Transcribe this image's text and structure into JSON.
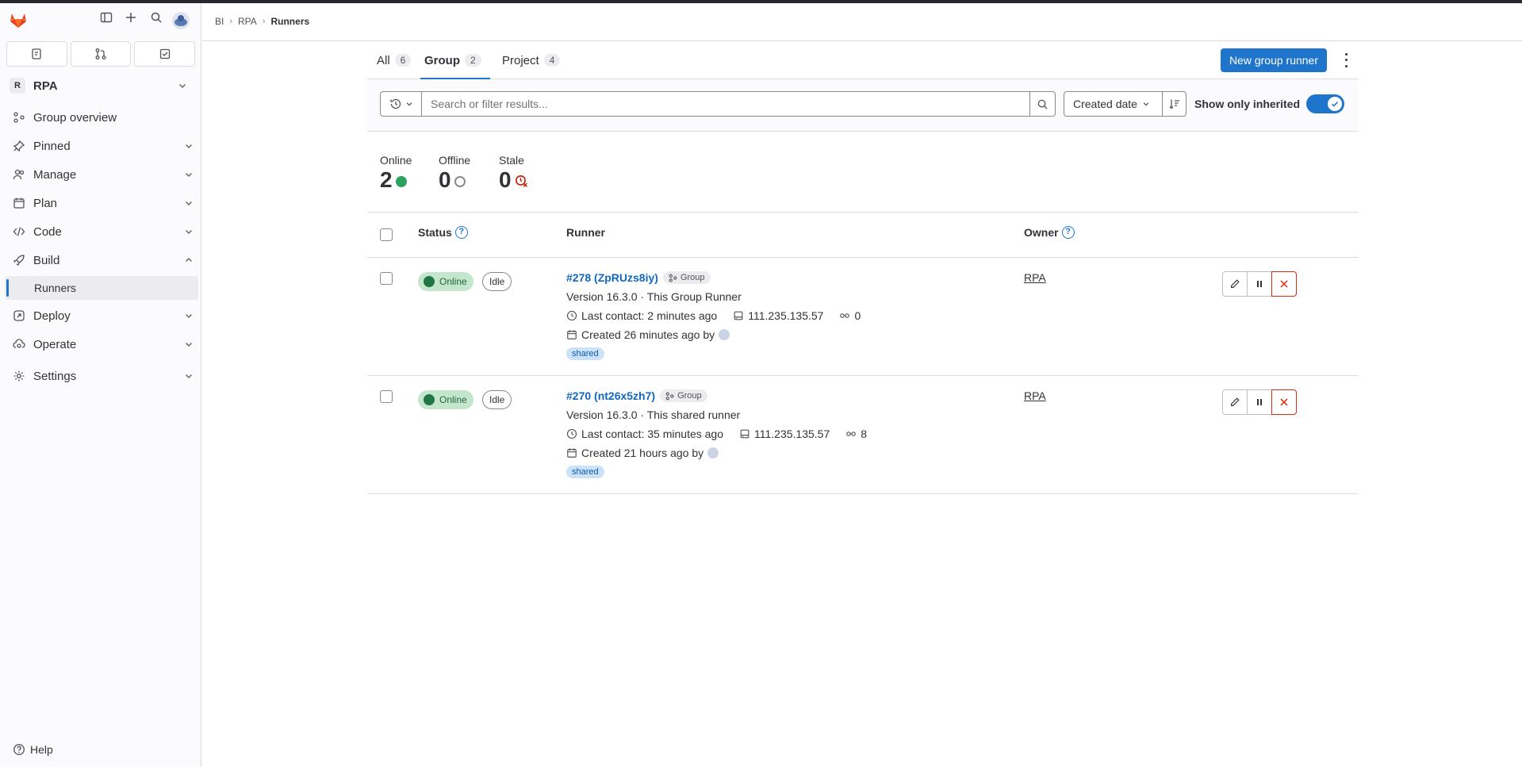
{
  "sidebar": {
    "context": {
      "avatar_letter": "R",
      "name": "RPA"
    },
    "items": [
      {
        "label": "Group overview"
      },
      {
        "label": "Pinned"
      },
      {
        "label": "Manage"
      },
      {
        "label": "Plan"
      },
      {
        "label": "Code"
      },
      {
        "label": "Build"
      },
      {
        "label": "Runners"
      },
      {
        "label": "Deploy"
      },
      {
        "label": "Operate"
      },
      {
        "label": "Settings"
      }
    ],
    "help": "Help"
  },
  "breadcrumb": {
    "items": [
      "BI",
      "RPA"
    ],
    "current": "Runners"
  },
  "tabs": [
    {
      "label": "All",
      "count": "6"
    },
    {
      "label": "Group",
      "count": "2"
    },
    {
      "label": "Project",
      "count": "4"
    }
  ],
  "new_runner_label": "New group runner",
  "filter": {
    "placeholder": "Search or filter results...",
    "sort_label": "Created date",
    "inherited_label": "Show only inherited"
  },
  "stats": [
    {
      "label": "Online",
      "value": "2"
    },
    {
      "label": "Offline",
      "value": "0"
    },
    {
      "label": "Stale",
      "value": "0"
    }
  ],
  "table": {
    "headers": {
      "status": "Status",
      "runner": "Runner",
      "owner": "Owner"
    },
    "rows": [
      {
        "status": "Online",
        "state": "Idle",
        "id": "#278 (ZpRUzs8iy)",
        "type": "Group",
        "version": "Version 16.3.0 · This Group Runner",
        "last_contact": "Last contact: 2 minutes ago",
        "ip": "111.235.135.57",
        "jobs": "0",
        "created": "Created 26 minutes ago by",
        "tag": "shared",
        "owner": "RPA"
      },
      {
        "status": "Online",
        "state": "Idle",
        "id": "#270 (nt26x5zh7)",
        "type": "Group",
        "version": "Version 16.3.0 · This shared runner",
        "last_contact": "Last contact: 35 minutes ago",
        "ip": "111.235.135.57",
        "jobs": "8",
        "created": "Created 21 hours ago by",
        "tag": "shared",
        "owner": "RPA"
      }
    ]
  },
  "colors": {
    "primary": "#1f75cb",
    "online": "#2da160",
    "danger": "#dd2b0e"
  }
}
